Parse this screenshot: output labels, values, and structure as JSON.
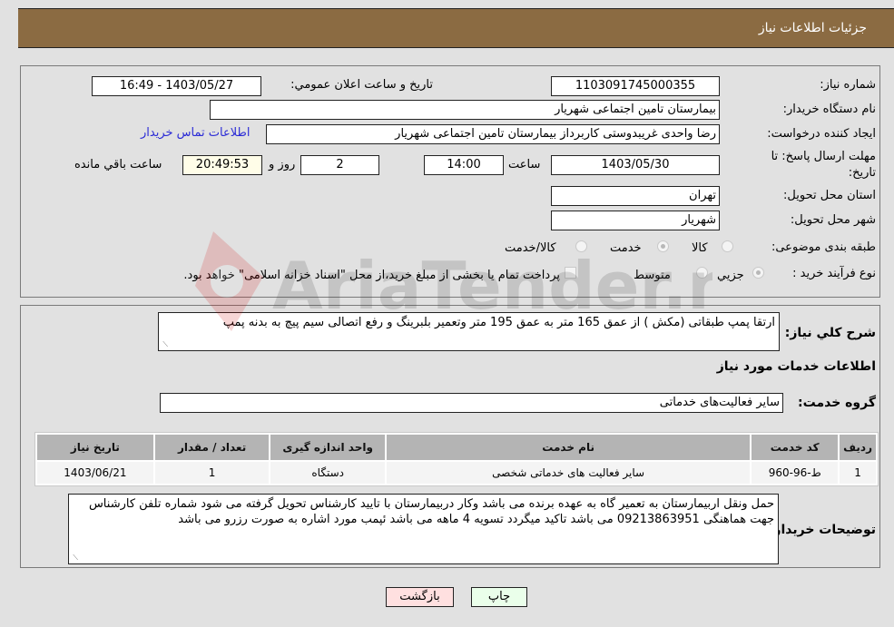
{
  "header": {
    "title": "جزئیات اطلاعات نیاز"
  },
  "details": {
    "need_number_label": "شماره نیاز:",
    "need_number": "1103091745000355",
    "announce_label": "تاريخ و ساعت اعلان عمومي:",
    "announce_value": "1403/05/27 - 16:49",
    "buyer_org_label": "نام دستگاه خريدار:",
    "buyer_org": "بیمارستان تامین اجتماعی شهریار",
    "creator_label": "ايجاد کننده درخواست:",
    "creator": "رضا واحدی غریبدوستی کاربرداز بیمارستان تامین اجتماعی شهریار",
    "contact_link": "اطلاعات تماس خريدار",
    "deadline_label_line1": "مهلت ارسال پاسخ: تا",
    "deadline_label_line2": "تاريخ:",
    "deadline_date": "1403/05/30",
    "time_label": "ساعت",
    "deadline_time": "14:00",
    "days_value": "2",
    "days_label": "روز و",
    "remaining_time": "20:49:53",
    "remaining_label": "ساعت باقي مانده",
    "province_label": "استان محل تحويل:",
    "province": "تهران",
    "city_label": "شهر محل تحويل:",
    "city": "شهریار",
    "category_label": "طبقه بندی موضوعی:",
    "category_options": [
      {
        "label": "کالا",
        "checked": false
      },
      {
        "label": "خدمت",
        "checked": true
      },
      {
        "label": "کالا/خدمت",
        "checked": false
      }
    ],
    "process_label": "نوع فرآيند خريد :",
    "process_options": [
      {
        "label": "جزيي",
        "checked": true
      },
      {
        "label": "متوسط",
        "checked": false
      }
    ],
    "treasury_note": "پرداخت تمام يا بخشی از مبلغ خريد،از محل \"اسناد خزانه اسلامی\" خواهد بود.",
    "treasury_checked": false
  },
  "need": {
    "description_label": "شرح کلي نياز:",
    "description": "ارتقا پمپ طبقاتی (مکش ) از عمق 165 متر به عمق 195 متر وتعمیر بلبرینگ و رفع اتصالی سیم پیچ به بدنه پمپ",
    "services_heading": "اطلاعات خدمات مورد نياز",
    "service_group_label": "گروه خدمت:",
    "service_group": "سایر فعالیت‌های خدماتی",
    "table": {
      "headers": [
        "رديف",
        "کد خدمت",
        "نام خدمت",
        "واحد اندازه گيری",
        "تعداد / مقدار",
        "تاريخ نياز"
      ],
      "rows": [
        [
          "1",
          "ط-96-960",
          "سایر فعالیت های خدماتی شخصی",
          "دستگاه",
          "1",
          "1403/06/21"
        ]
      ]
    },
    "buyer_notes_label": "توضيحات خريدار:",
    "buyer_notes": "حمل ونقل اربیمارستان به تعمیر گاه به عهده برنده می باشد  وکار دربیمارستان با تایید کارشناس تحویل گرفته می شود شماره تلفن کارشناس جهت هماهنگی 09213863951 می باشد تاکید میگردد تسویه 4 ماهه می باشد ئپمب مورد اشاره به صورت رزرو می باشد"
  },
  "buttons": {
    "print": "چاپ",
    "back": "بازگشت"
  },
  "watermark": {
    "text": "AriaTender.neT"
  }
}
